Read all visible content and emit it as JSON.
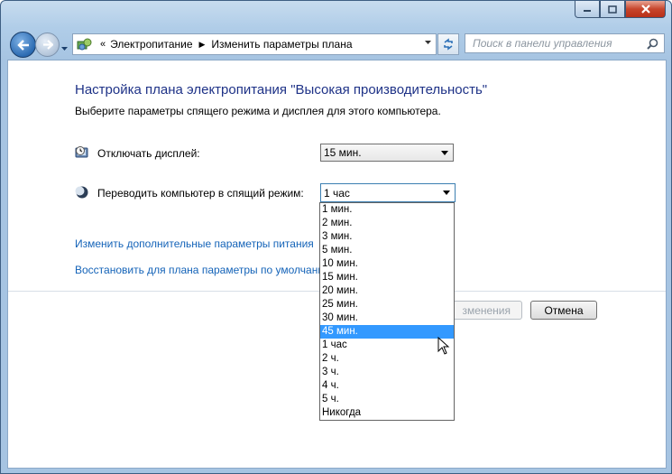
{
  "window": {
    "controls": {
      "minimize_icon": "minimize-icon",
      "maximize_icon": "maximize-icon",
      "close_icon": "close-icon"
    }
  },
  "address": {
    "chevron": "«",
    "crumbs": [
      "Электропитание",
      "Изменить параметры плана"
    ]
  },
  "search": {
    "placeholder": "Поиск в панели управления"
  },
  "page": {
    "title": "Настройка плана электропитания \"Высокая производительность\"",
    "subtitle": "Выберите параметры спящего режима и дисплея для этого компьютера.",
    "display_label": "Отключать дисплей:",
    "display_value": "15 мин.",
    "sleep_label": "Переводить компьютер в спящий режим:",
    "sleep_value": "1 час",
    "link_advanced": "Изменить дополнительные параметры питания",
    "link_restore": "Восстановить для плана параметры по умолчанию",
    "save_button": "Сохранить изменения",
    "save_button_visible": "зменения",
    "cancel_button": "Отмена"
  },
  "dropdown": {
    "options": [
      "1 мин.",
      "2 мин.",
      "3 мин.",
      "5 мин.",
      "10 мин.",
      "15 мин.",
      "20 мин.",
      "25 мин.",
      "30 мин.",
      "45 мин.",
      "1 час",
      "2 ч.",
      "3 ч.",
      "4 ч.",
      "5 ч.",
      "Никогда"
    ],
    "highlighted": "45 мин.",
    "highlight_color": "#3399ff"
  },
  "colors": {
    "title": "#1e3287",
    "link": "#1463b8"
  }
}
